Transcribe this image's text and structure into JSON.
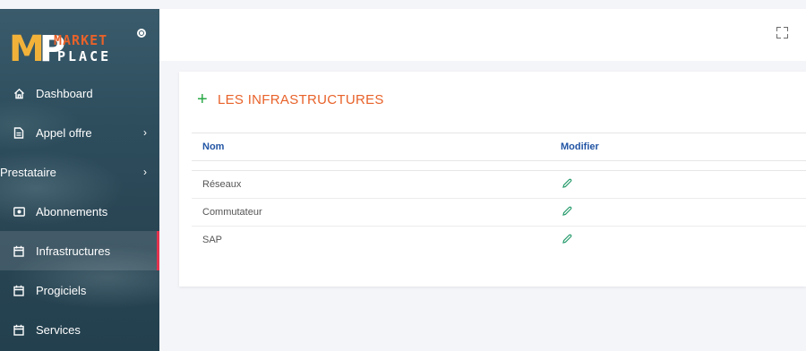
{
  "brand": {
    "mark": "MP",
    "line1": "MARKET",
    "line2": "PLACE"
  },
  "sidebar": {
    "items": [
      {
        "label": "Dashboard",
        "icon": "home-icon"
      },
      {
        "label": "Appel offre",
        "icon": "file-icon",
        "chevron": "›"
      },
      {
        "label": "Prestataire",
        "chevron": "›"
      },
      {
        "label": "Abonnements",
        "icon": "money-icon"
      },
      {
        "label": "Infrastructures",
        "icon": "calendar-icon",
        "active": true
      },
      {
        "label": "Progiciels",
        "icon": "calendar-icon"
      },
      {
        "label": "Services",
        "icon": "calendar-icon"
      }
    ]
  },
  "card": {
    "title": "LES INFRASTRUCTURES",
    "columns": [
      "Nom",
      "Modifier"
    ],
    "rows": [
      {
        "name": "Réseaux"
      },
      {
        "name": "Commutateur"
      },
      {
        "name": "SAP"
      }
    ]
  },
  "colors": {
    "accent": "#e8622a",
    "add": "#27a844",
    "header_text": "#2255a4",
    "active_border": "#e2334f",
    "pencil": "#2a9d6f"
  }
}
